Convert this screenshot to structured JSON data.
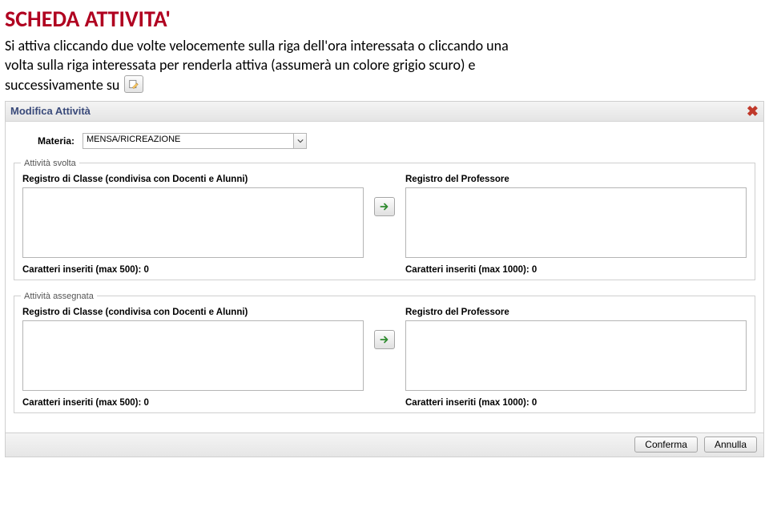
{
  "doc": {
    "title": "SCHEDA ATTIVITA'",
    "para_line1": "Si attiva cliccando due volte velocemente sulla riga dell'ora interessata o cliccando una",
    "para_line2": "volta sulla riga interessata per renderla attiva (assumerà un colore grigio scuro) e",
    "para_line3_prefix": "successivamente su"
  },
  "dialog": {
    "title": "Modifica Attività",
    "materia_label": "Materia:",
    "materia_value": "MENSA/RICREAZIONE",
    "fieldset_svolta": "Attività svolta",
    "fieldset_assegnata": "Attività assegnata",
    "col_classe": "Registro di Classe (condivisa con Docenti e Alunni)",
    "col_prof": "Registro del Professore",
    "counter500": "Caratteri inseriti (max 500): 0",
    "counter1000": "Caratteri inseriti (max 1000): 0",
    "btn_ok": "Conferma",
    "btn_cancel": "Annulla"
  }
}
